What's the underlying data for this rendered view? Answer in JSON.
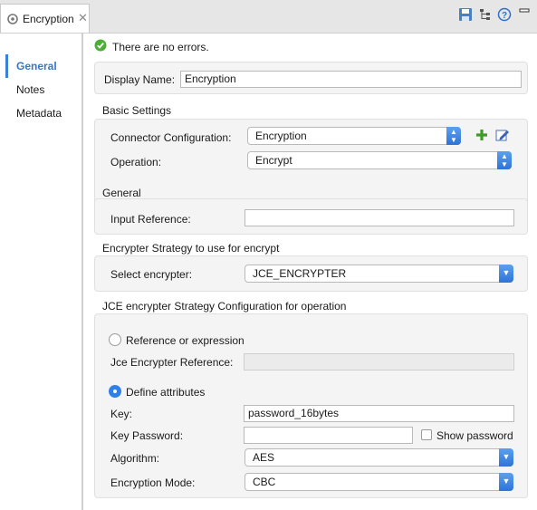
{
  "tab": {
    "title": "Encryption"
  },
  "sidebar": {
    "items": [
      {
        "label": "General"
      },
      {
        "label": "Notes"
      },
      {
        "label": "Metadata"
      }
    ]
  },
  "status": {
    "text": "There are no errors."
  },
  "display_name": {
    "label": "Display Name:",
    "value": "Encryption"
  },
  "basic": {
    "title": "Basic Settings",
    "connector_label": "Connector Configuration:",
    "connector_value": "Encryption",
    "operation_label": "Operation:",
    "operation_value": "Encrypt"
  },
  "general": {
    "title": "General",
    "input_ref_label": "Input Reference:",
    "input_ref_value": ""
  },
  "strategy": {
    "title": "Encrypter Strategy to use for encrypt",
    "select_label": "Select encrypter:",
    "select_value": "JCE_ENCRYPTER"
  },
  "jce": {
    "title": "JCE encrypter Strategy Configuration for operation",
    "ref_expr_label": "Reference or expression",
    "jce_ref_label": "Jce Encrypter Reference:",
    "jce_ref_value": "",
    "define_label": "Define attributes",
    "key_label": "Key:",
    "key_value": "password_16bytes",
    "key_password_label": "Key Password:",
    "key_password_value": "",
    "show_password_label": "Show password",
    "algorithm_label": "Algorithm:",
    "algorithm_value": "AES",
    "mode_label": "Encryption Mode:",
    "mode_value": "CBC"
  }
}
